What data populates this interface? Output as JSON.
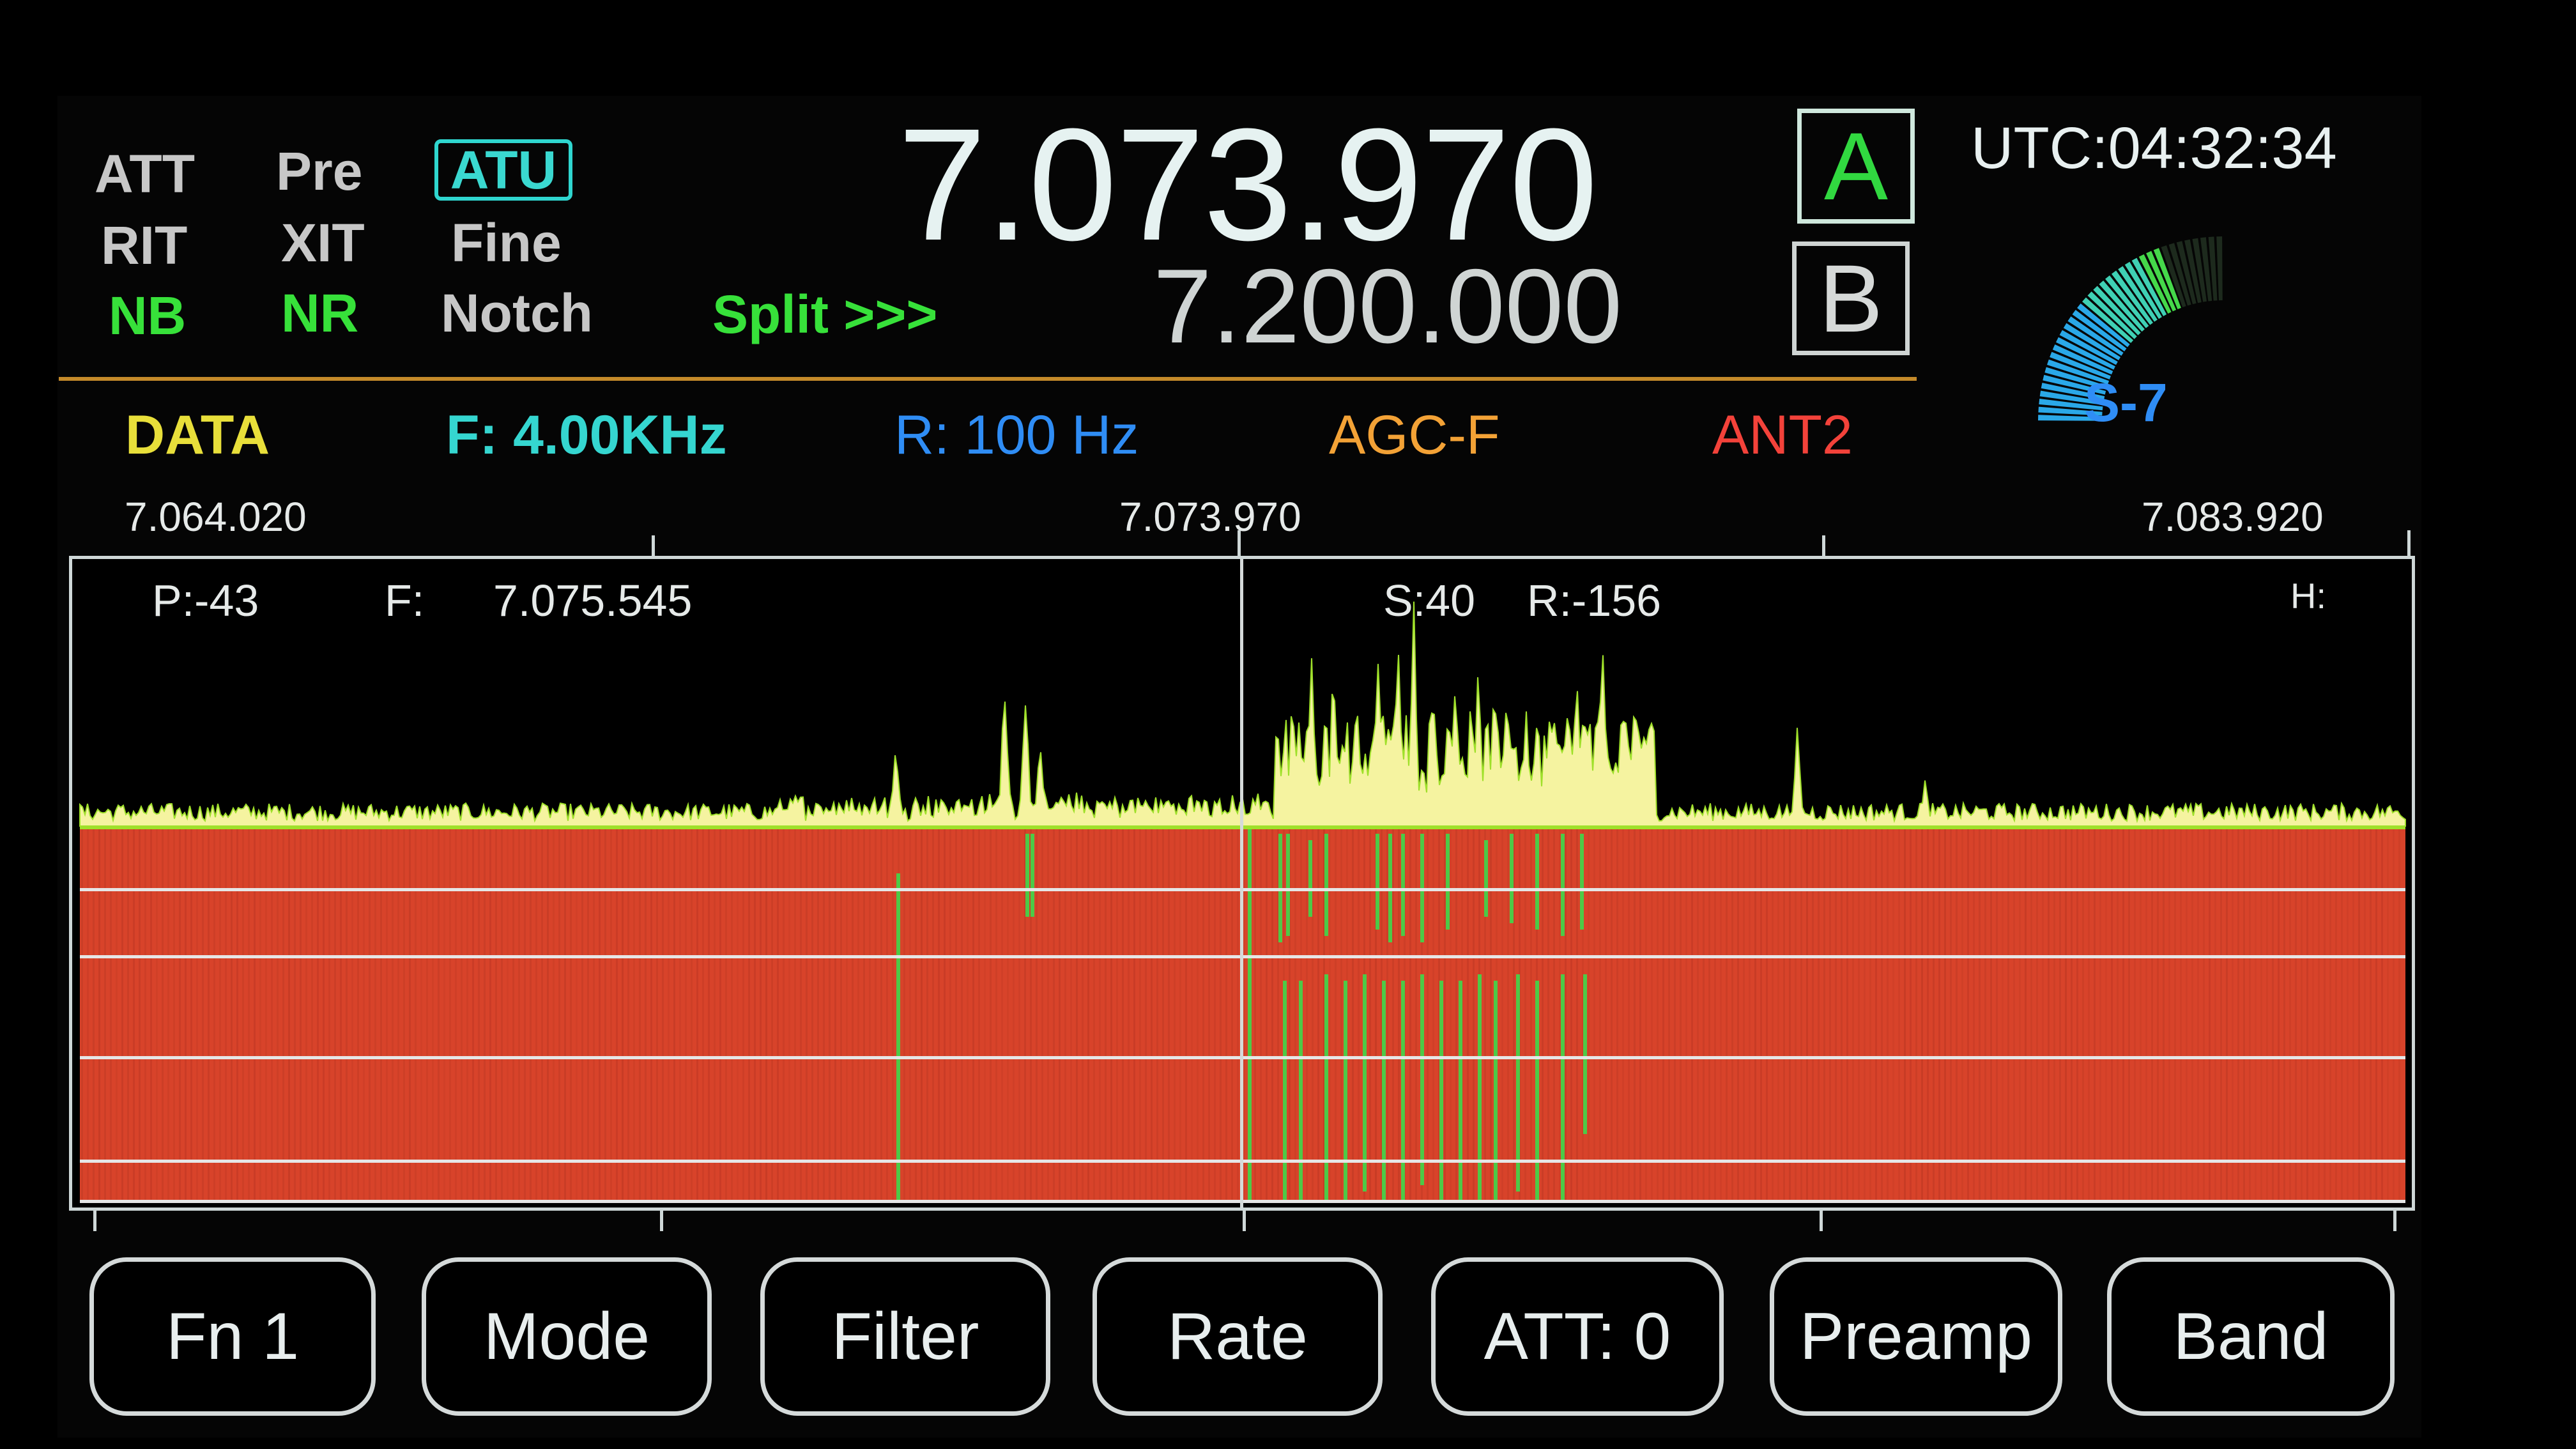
{
  "indicators": {
    "att": "ATT",
    "pre": "Pre",
    "atu": "ATU",
    "rit": "RIT",
    "xit": "XIT",
    "fine": "Fine",
    "nb": "NB",
    "nr": "NR",
    "notch": "Notch",
    "split": "Split >>>"
  },
  "vfo": {
    "a_frequency": "7.073.970",
    "b_frequency": "7.200.000",
    "a_label": "A",
    "b_label": "B"
  },
  "clock": {
    "utc": "UTC:04:32:34"
  },
  "smeter": {
    "reading": "S-7",
    "level": 7,
    "max_level": 9
  },
  "status": {
    "mode": "DATA",
    "filter": "F: 4.00KHz",
    "rate": "R: 100 Hz",
    "agc": "AGC-F",
    "antenna": "ANT2"
  },
  "spectrum": {
    "start": "7.064.020",
    "center": "7.073.970",
    "end": "7.083.920",
    "peak_label": "P:-43",
    "f_label": "F:",
    "f_value": "7.075.545",
    "s_label": "S:40",
    "r_label": "R:-156",
    "h_label": "H:"
  },
  "softkeys": [
    "Fn 1",
    "Mode",
    "Filter",
    "Rate",
    "ATT:  0",
    "Preamp",
    "Band"
  ],
  "colors": {
    "waterfall": "#d8432a",
    "trace": "#f5f3a0",
    "trace_edge": "#9fe02a",
    "signal": "#3fd84a",
    "accent_cyan": "#2fd6cf",
    "mode_yellow": "#e8df3a",
    "rate_blue": "#2f8df5",
    "agc_orange": "#f3a236",
    "ant_red": "#f3423a"
  }
}
